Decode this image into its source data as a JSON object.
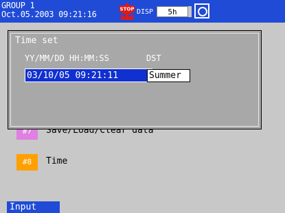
{
  "header": {
    "group": "GROUP 1",
    "datetime": "Oct.05.2003 09:21:16",
    "stop_icon": "stop-icon",
    "disp_label": "DISP",
    "time_value": "5h",
    "camera_icon": "camera-icon",
    "background": "#1f4bd6"
  },
  "menu": {
    "item7": {
      "badge": "#7",
      "label": "Save/Load/Clear data",
      "color": "#e080e0"
    },
    "item8": {
      "badge": "#8",
      "label": "Time",
      "color": "#ffa000"
    }
  },
  "dialog": {
    "title": "Time set",
    "datetime_header": "YY/MM/DD HH:MM:SS",
    "dst_header": "DST",
    "datetime_value": "03/10/05 09:21:11",
    "dst_value": "Summer"
  },
  "footer": {
    "input_tab": "Input"
  }
}
